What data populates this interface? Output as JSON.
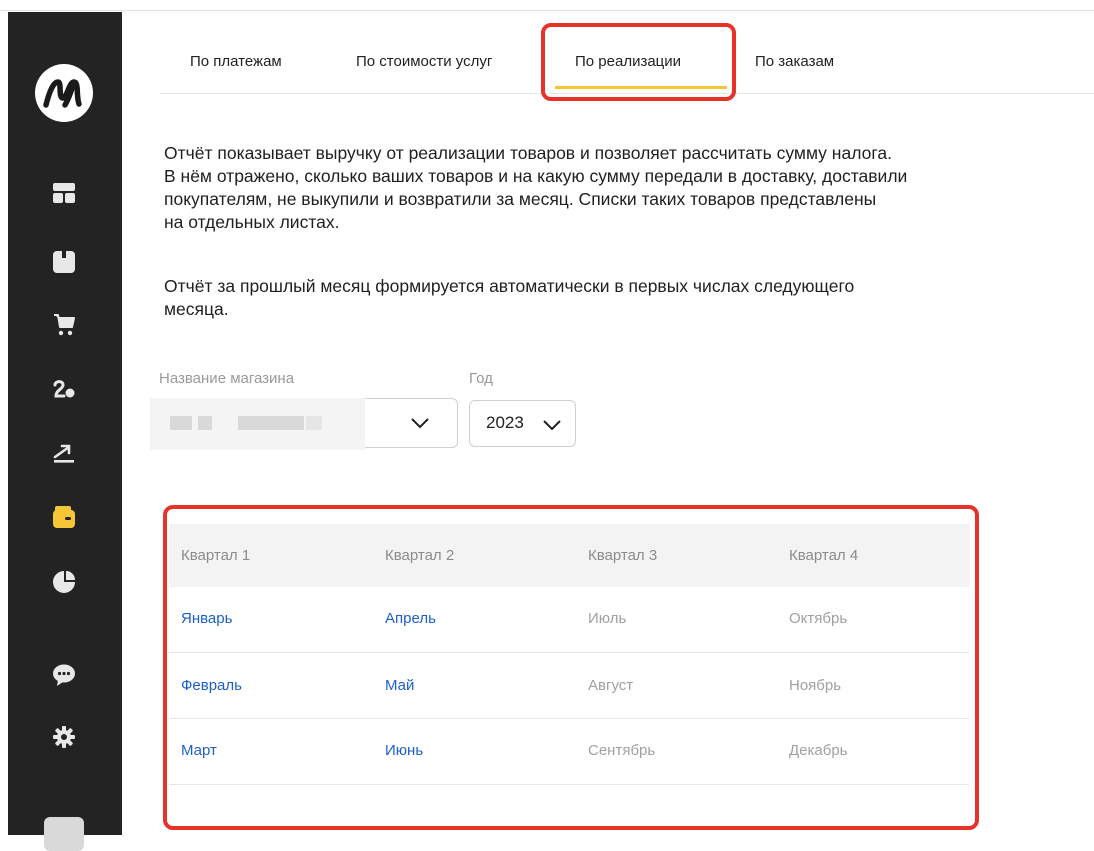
{
  "tabs": [
    {
      "label": "По платежам"
    },
    {
      "label": "По стоимости услуг"
    },
    {
      "label": "По реализации",
      "active": true
    },
    {
      "label": "По заказам"
    }
  ],
  "description": {
    "paragraph1_lines": [
      "Отчёт показывает выручку от реализации товаров и позволяет рассчитать сумму налога.",
      "В нём отражено, сколько ваших товаров и на какую сумму передали в доставку, доставили",
      "покупателям, не выкупили и возвратили за месяц. Списки таких товаров представлены",
      "на отдельных листах."
    ],
    "paragraph2_lines": [
      "Отчёт за прошлый месяц формируется автоматически в первых числах следующего",
      "месяца."
    ]
  },
  "filters": {
    "store_label": "Название магазина",
    "year_label": "Год",
    "year_value": "2023"
  },
  "quarters": {
    "headers": [
      "Квартал 1",
      "Квартал 2",
      "Квартал 3",
      "Квартал 4"
    ],
    "rows": [
      [
        "Январь",
        "Апрель",
        "Июль",
        "Октябрь"
      ],
      [
        "Февраль",
        "Май",
        "Август",
        "Ноябрь"
      ],
      [
        "Март",
        "Июнь",
        "Сентябрь",
        "Декабрь"
      ]
    ],
    "available_quarters": 2
  },
  "sidebar": {
    "icons": [
      "market-logo-icon",
      "dashboard-icon",
      "box-icon",
      "cart-icon",
      "customers-icon",
      "growth-icon",
      "wallet-icon",
      "pie-chart-icon",
      "chat-icon",
      "gear-icon"
    ],
    "active_icon": "wallet-icon"
  },
  "colors": {
    "accent_yellow": "#f6c636",
    "link_blue": "#1d5fc9",
    "highlight_red": "#e5332a",
    "sidebar_bg": "#232323"
  }
}
